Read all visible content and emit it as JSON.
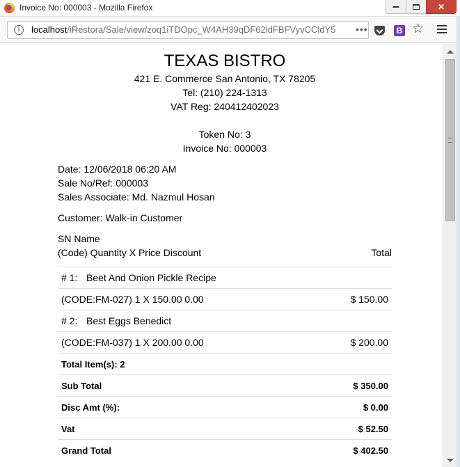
{
  "window": {
    "title": "Invoice No: 000003 - Mozilla Firefox",
    "close_glyph": "✕"
  },
  "toolbar": {
    "info_glyph": "i",
    "url_host": "localhost",
    "url_path": "/iRestora/Sale/view/zoq1iTDOpc_W4AH39qDF62ldFBFVyvCCldY5",
    "page_actions_glyph": "•••",
    "bookmark_glyph": "☆",
    "extension_label": "B"
  },
  "receipt": {
    "shop_name": "TEXAS BISTRO",
    "address": "421 E. Commerce San Antonio, TX 78205",
    "phone": "Tel: (210) 224-1313",
    "vat_reg": "VAT Reg: 240412402023",
    "token": "Token No: 3",
    "invoice_no": "Invoice No: 000003",
    "date": "Date: 12/06/2018 06:20 AM",
    "sale_ref": "Sale No/Ref: 000003",
    "sales_associate": "Sales Associate: Md. Nazmul Hosan",
    "customer": "Customer: Walk-in Customer",
    "columns": {
      "sn_name": "SN Name",
      "detail": "(Code) Quantity X Price Discount",
      "total": "Total"
    },
    "items": [
      {
        "sn": "# 1:",
        "name": "Beet And Onion Pickle Recipe",
        "detail": "(CODE:FM-027) 1 X 150.00 0.00",
        "total": "$ 150.00"
      },
      {
        "sn": "# 2:",
        "name": "Best Eggs Benedict",
        "detail": "(CODE:FM-037) 1 X 200.00 0.00",
        "total": "$ 200.00"
      }
    ],
    "summary": {
      "total_items": "Total Item(s): 2",
      "sub_total_label": "Sub Total",
      "sub_total_value": "$ 350.00",
      "disc_label": "Disc Amt (%):",
      "disc_value": "$ 0.00",
      "vat_label": "Vat",
      "vat_value": "$ 52.50",
      "grand_total_label": "Grand Total",
      "grand_total_value": "$ 402.50"
    }
  }
}
